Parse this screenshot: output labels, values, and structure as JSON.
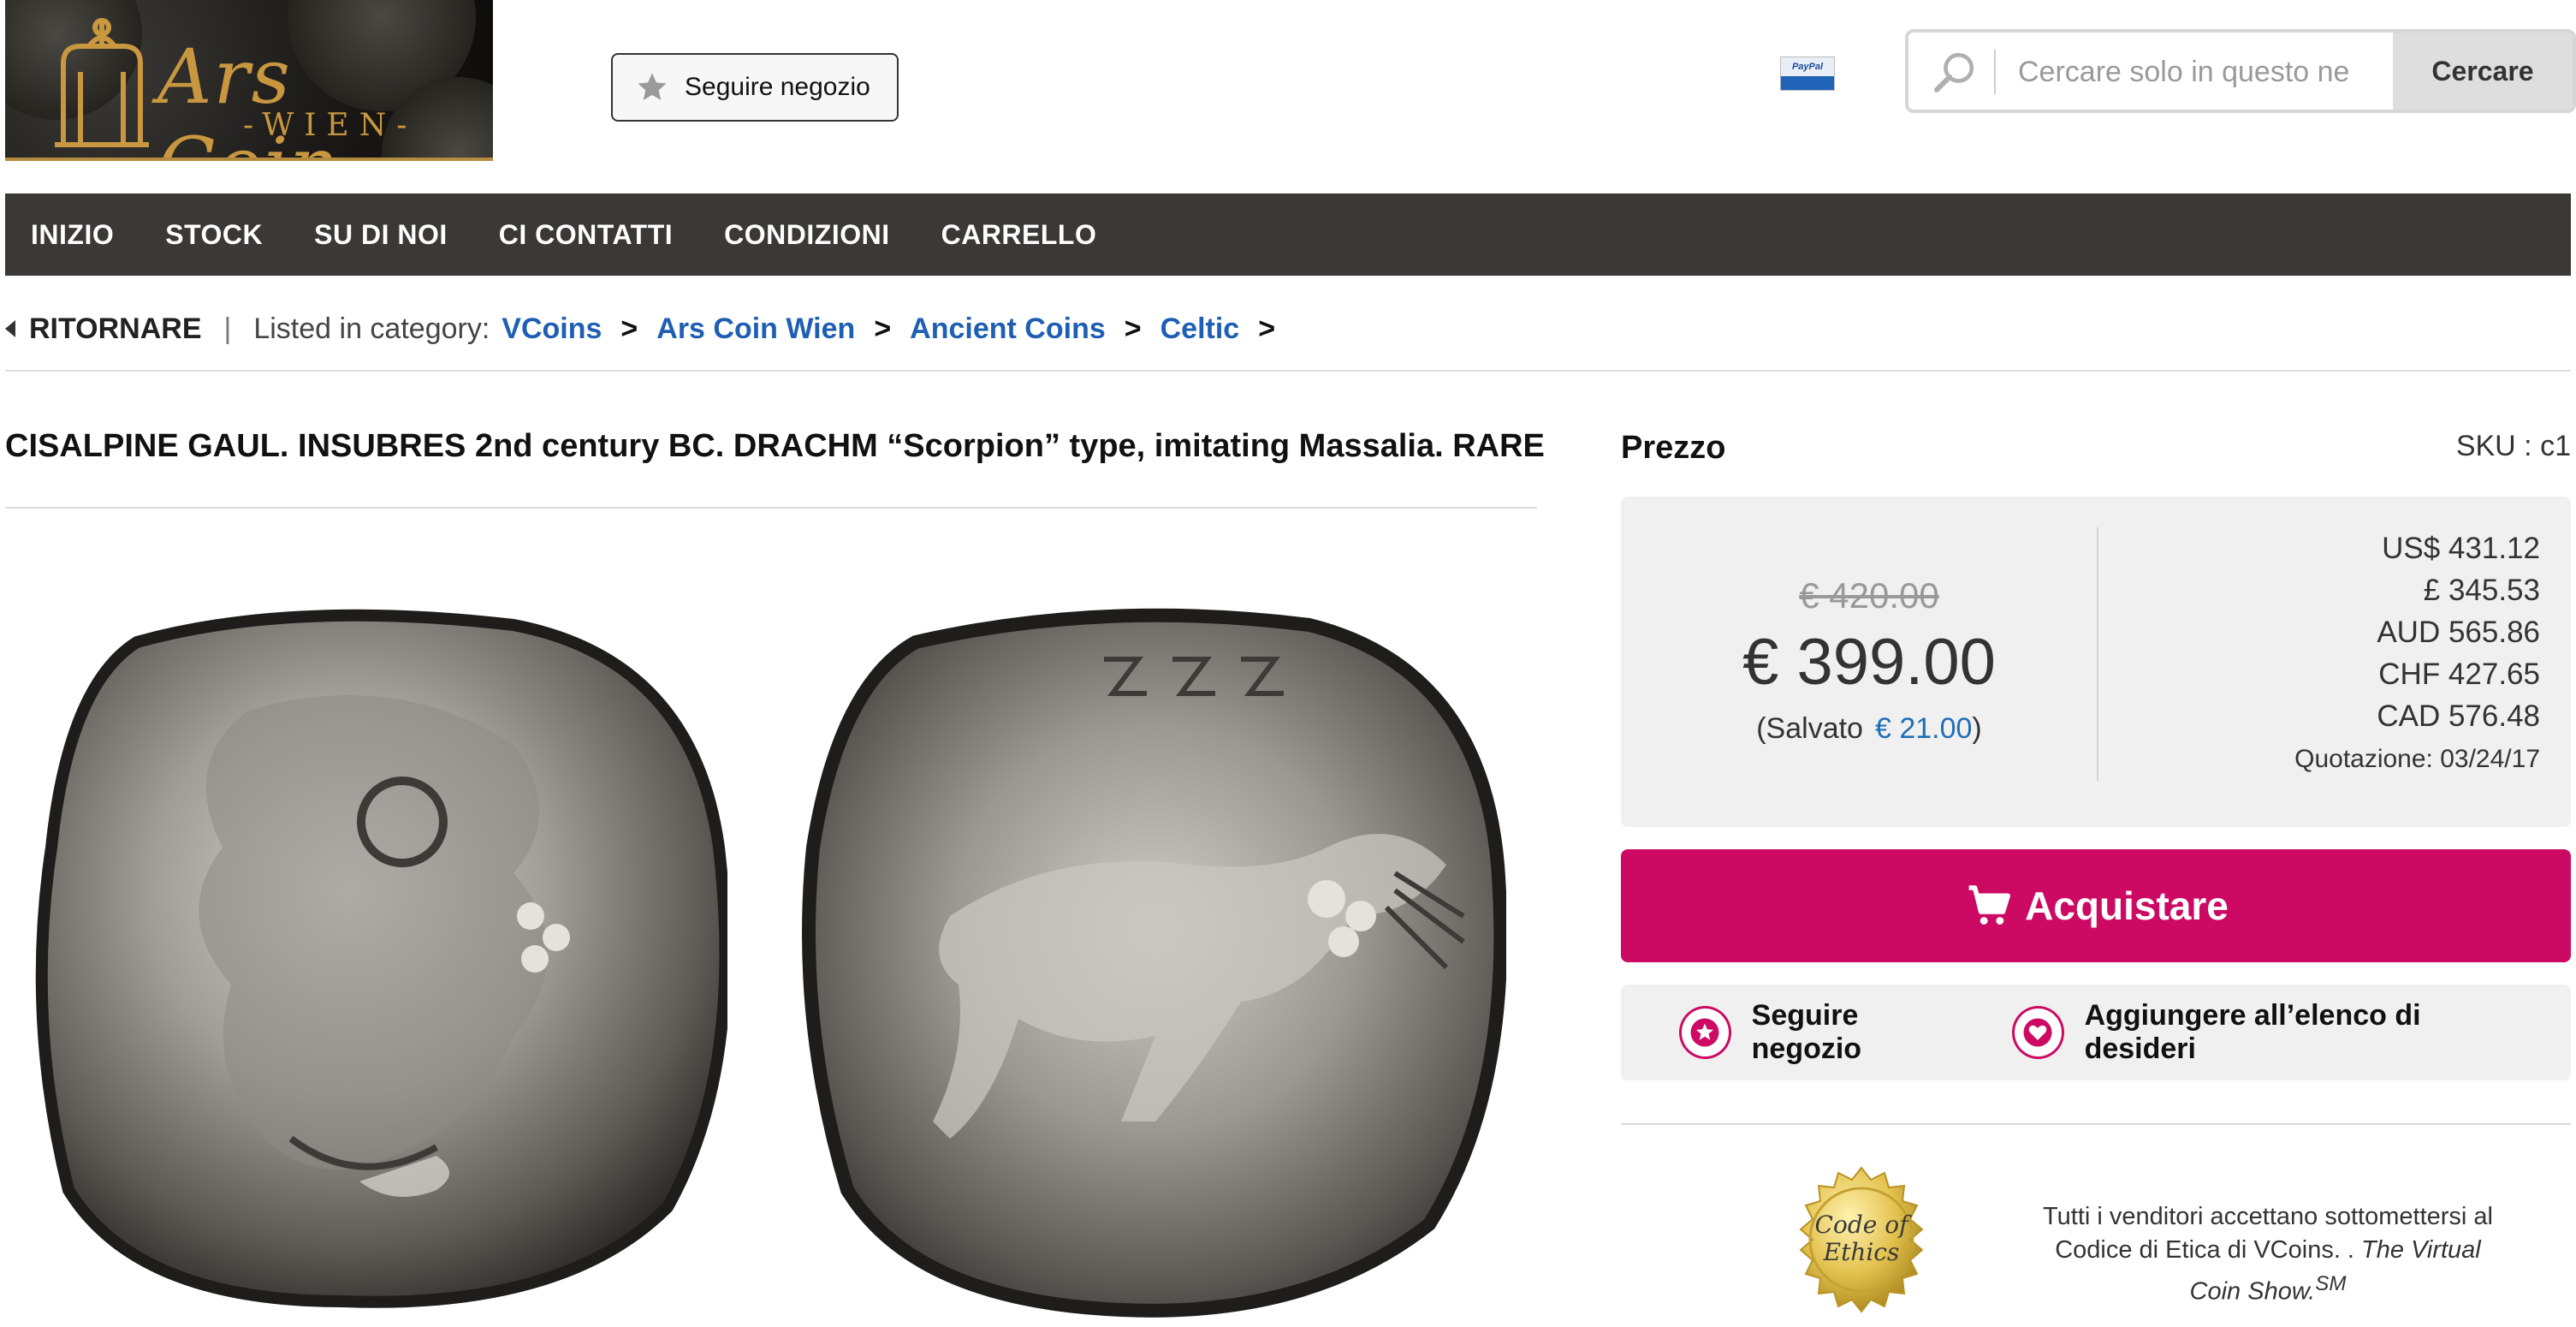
{
  "header": {
    "logo": {
      "brand": "Ars Coin",
      "sub": "WIEN"
    },
    "follow_label": "Seguire negozio",
    "paypal_label": "PayPal",
    "search": {
      "placeholder": "Cercare solo in questo ne",
      "button_label": "Cercare"
    }
  },
  "nav": {
    "items": [
      {
        "label": "INIZIO"
      },
      {
        "label": "STOCK"
      },
      {
        "label": "SU DI NOI"
      },
      {
        "label": "CI CONTATTI"
      },
      {
        "label": "CONDIZIONI"
      },
      {
        "label": "CARRELLO"
      }
    ]
  },
  "breadcrumb": {
    "back_label": "RITORNARE",
    "separator": "|",
    "listed_label": "Listed in category:",
    "items": [
      {
        "label": "VCoins"
      },
      {
        "label": "Ars Coin Wien"
      },
      {
        "label": "Ancient Coins"
      },
      {
        "label": "Celtic"
      }
    ],
    "arrow": ">"
  },
  "product": {
    "title": "CISALPINE GAUL. INSUBRES 2nd century BC. DRACHM “Scorpion” type, imitating Massalia. RARE"
  },
  "price": {
    "heading": "Prezzo",
    "sku": "SKU : c1",
    "old": "€ 420.00",
    "current": "€ 399.00",
    "saved_prefix": "(Salvato",
    "saved_amount": "€ 21.00",
    "saved_suffix": ")",
    "conversions": [
      {
        "text": "US$ 431.12"
      },
      {
        "text": "£ 345.53"
      },
      {
        "text": "AUD 565.86"
      },
      {
        "text": "CHF 427.65"
      },
      {
        "text": "CAD 576.48"
      }
    ],
    "quotation": "Quotazione: 03/24/17",
    "buy_label": "Acquistare",
    "follow_label": "Seguire negozio",
    "wishlist_label": "Aggiungere all’elenco di desideri"
  },
  "ethics": {
    "seal_line1": "Code of",
    "seal_line2": "Ethics",
    "text_main": "Tutti i venditori accettano sottomettersi al Codice di Etica di VCoins. . ",
    "text_italic": "The Virtual Coin Show.",
    "text_sup": "SM"
  },
  "colors": {
    "nav_bg": "#3b3835",
    "accent": "#cc0a63",
    "link": "#1f5fb3",
    "gold": "#c9973f"
  },
  "icons": {
    "search": "magnifier-icon",
    "star": "star-icon",
    "cart": "cart-icon",
    "heart": "heart-icon",
    "back": "caret-left-icon"
  }
}
